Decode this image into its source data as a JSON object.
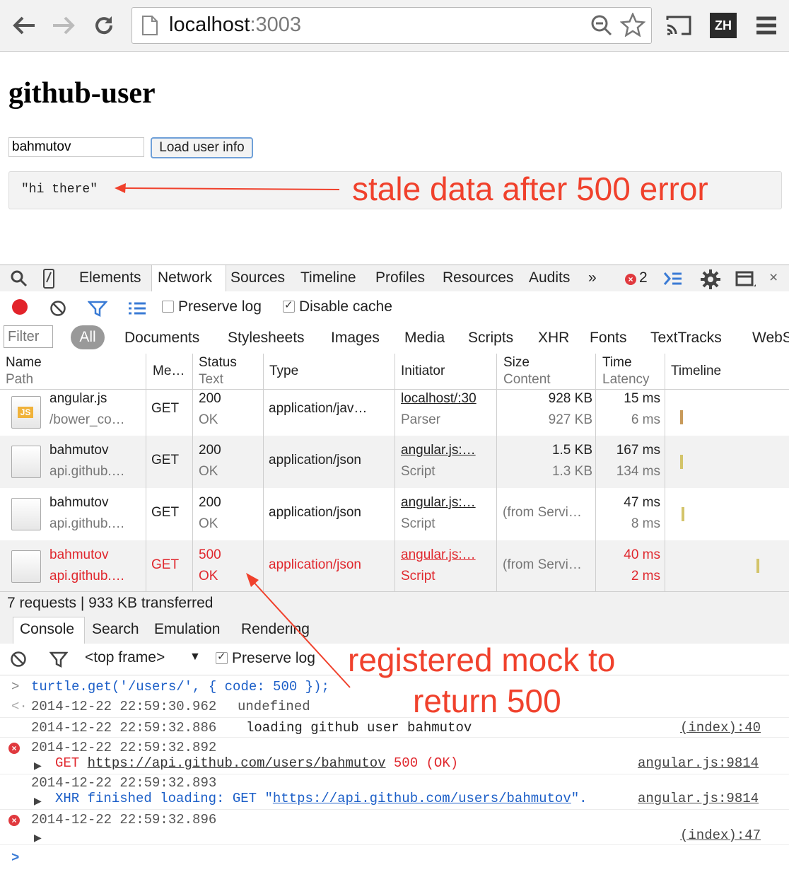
{
  "browser": {
    "url_host": "localhost",
    "url_port": ":3003",
    "profile_badge": "ZH"
  },
  "page": {
    "title": "github-user",
    "username_value": "bahmutov",
    "load_button": "Load user info",
    "result_text": "\"hi there\""
  },
  "annotations": {
    "stale": "stale data after 500 error",
    "mock_line1": "registered mock to",
    "mock_line2": "return 500"
  },
  "devtools": {
    "tabs": [
      "Elements",
      "Network",
      "Sources",
      "Timeline",
      "Profiles",
      "Resources",
      "Audits"
    ],
    "more": "»",
    "error_count": "2",
    "preserve_log": "Preserve log",
    "disable_cache": "Disable cache",
    "filter_placeholder": "Filter",
    "type_filters": [
      "All",
      "Documents",
      "Stylesheets",
      "Images",
      "Media",
      "Scripts",
      "XHR",
      "Fonts",
      "TextTracks",
      "WebS"
    ],
    "columns": {
      "name": "Name",
      "path": "Path",
      "method": "Me…",
      "status": "Status",
      "text": "Text",
      "type": "Type",
      "initiator": "Initiator",
      "size": "Size",
      "content": "Content",
      "time": "Time",
      "latency": "Latency",
      "timeline": "Timeline"
    },
    "requests": [
      {
        "name": "angular.js",
        "path": "/bower_co…",
        "method": "GET",
        "status": "200",
        "text": "OK",
        "type": "application/jav…",
        "initiator": "localhost/:30",
        "initiator_sub": "Parser",
        "size": "928 KB",
        "content": "927 KB",
        "time": "15 ms",
        "latency": "6 ms",
        "icon_label": "JS",
        "error": false
      },
      {
        "name": "bahmutov",
        "path": "api.github.…",
        "method": "GET",
        "status": "200",
        "text": "OK",
        "type": "application/json",
        "initiator": "angular.js:…",
        "initiator_sub": "Script",
        "size": "1.5 KB",
        "content": "1.3 KB",
        "time": "167 ms",
        "latency": "134 ms",
        "icon_label": "",
        "error": false
      },
      {
        "name": "bahmutov",
        "path": "api.github.…",
        "method": "GET",
        "status": "200",
        "text": "OK",
        "type": "application/json",
        "initiator": "angular.js:…",
        "initiator_sub": "Script",
        "size": "(from Servi…",
        "content": "",
        "time": "47 ms",
        "latency": "8 ms",
        "icon_label": "",
        "error": false
      },
      {
        "name": "bahmutov",
        "path": "api.github.…",
        "method": "GET",
        "status": "500",
        "text": "OK",
        "type": "application/json",
        "initiator": "angular.js:…",
        "initiator_sub": "Script",
        "size": "(from Servi…",
        "content": "",
        "time": "40 ms",
        "latency": "2 ms",
        "icon_label": "",
        "error": true
      }
    ],
    "summary": "7 requests | 933 KB transferred",
    "console_tabs": [
      "Console",
      "Search",
      "Emulation",
      "Rendering"
    ],
    "frame_select": "<top frame>",
    "console_preserve": "Preserve log"
  },
  "console": {
    "input_cmd": "turtle.get('/users/', { code: 500 });",
    "result_time": "2014-12-22 22:59:30.962",
    "result_value": "undefined",
    "log1_time": "2014-12-22 22:59:32.886",
    "log1_msg": "loading github user bahmutov",
    "log1_src": "(index):40",
    "err1_time": "2014-12-22 22:59:32.892",
    "err1_method": "GET",
    "err1_url": "https://api.github.com/users/bahmutov",
    "err1_status": "500 (OK)",
    "err1_src": "angular.js:9814",
    "log2_time": "2014-12-22 22:59:32.893",
    "log2_msg_prefix": "XHR finished loading: GET \"",
    "log2_url": "https://api.github.com/users/bahmutov",
    "log2_msg_suffix": "\".",
    "log2_src": "angular.js:9814",
    "err2_time": "2014-12-22 22:59:32.896",
    "err2_src": "(index):47"
  }
}
